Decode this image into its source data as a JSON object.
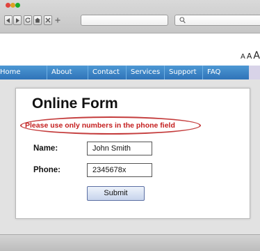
{
  "browser": {
    "buttons": [
      {
        "name": "back-icon"
      },
      {
        "name": "forward-icon"
      },
      {
        "name": "reload-icon"
      },
      {
        "name": "home-icon"
      },
      {
        "name": "close-icon"
      },
      {
        "name": "new-tab-icon"
      }
    ],
    "search_icon": "search-icon"
  },
  "text_size": {
    "small": "A",
    "medium": "A",
    "large": "A"
  },
  "nav": {
    "items": [
      {
        "label": "Home"
      },
      {
        "label": "About"
      },
      {
        "label": "Contact"
      },
      {
        "label": "Services"
      },
      {
        "label": "Support"
      },
      {
        "label": "FAQ"
      }
    ]
  },
  "form": {
    "title": "Online Form",
    "error": "Please use only numbers in the phone field",
    "name_label": "Name:",
    "name_value": "John Smith",
    "phone_label": "Phone:",
    "phone_value": "2345678x",
    "submit_label": "Submit"
  },
  "colors": {
    "nav": "#3a84c6",
    "error": "#c41e1e",
    "error_outline": "#c43c3c",
    "submit_bg": "#d6e0f2"
  }
}
